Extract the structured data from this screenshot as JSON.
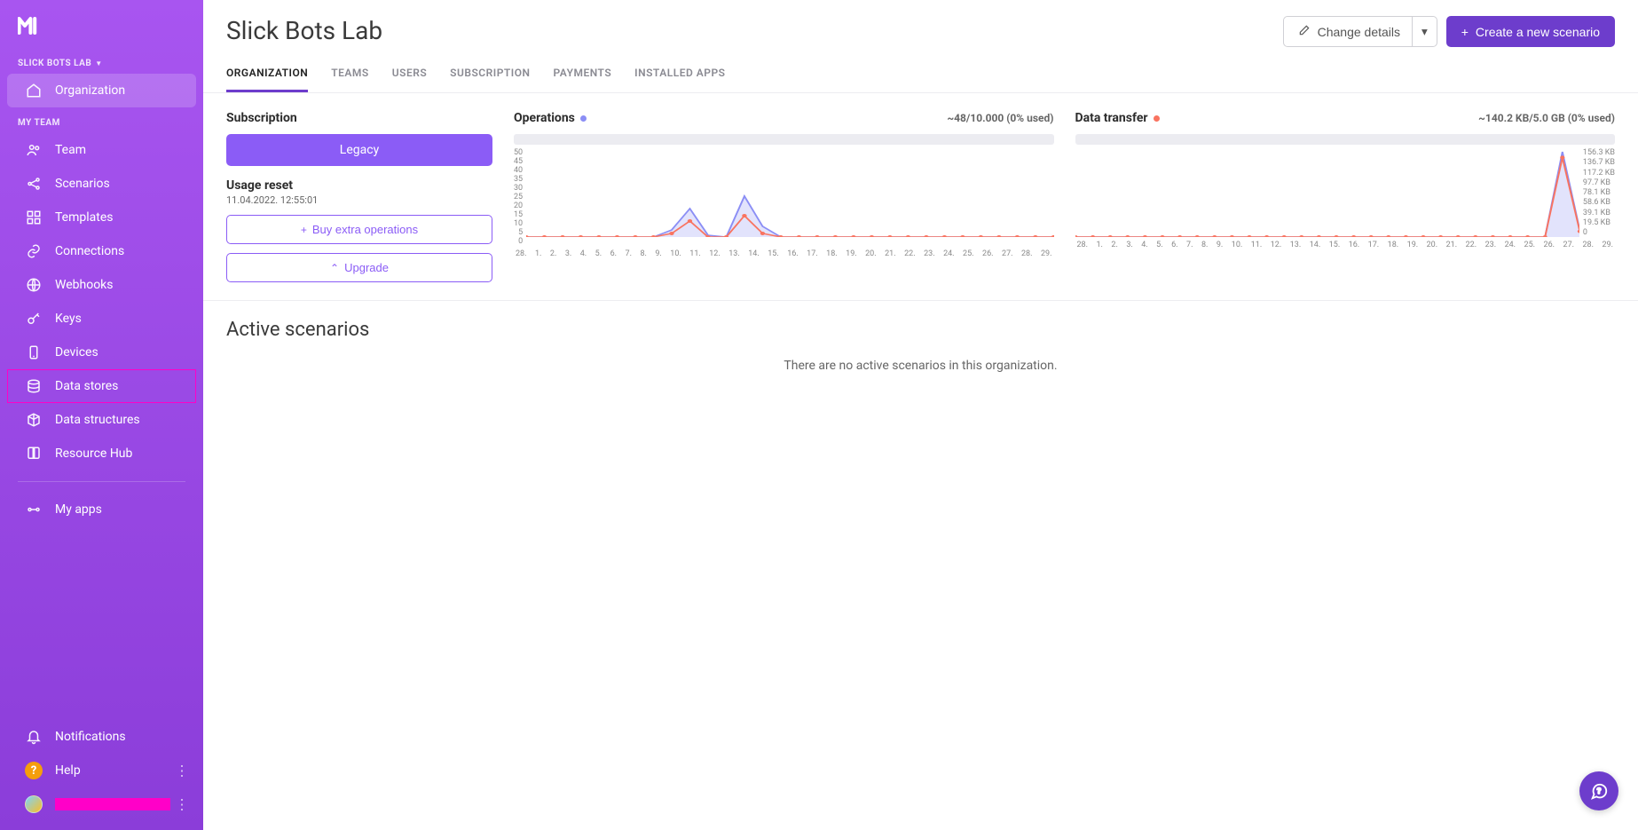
{
  "org": {
    "name": "Slick Bots Lab",
    "dropdown_label": "SLICK BOTS LAB"
  },
  "header": {
    "change_details": "Change details",
    "new_scenario": "Create a new scenario"
  },
  "tabs": [
    {
      "id": "organization",
      "label": "ORGANIZATION",
      "active": true
    },
    {
      "id": "teams",
      "label": "TEAMS"
    },
    {
      "id": "users",
      "label": "USERS"
    },
    {
      "id": "subscription",
      "label": "SUBSCRIPTION"
    },
    {
      "id": "payments",
      "label": "PAYMENTS"
    },
    {
      "id": "installed-apps",
      "label": "INSTALLED APPS"
    }
  ],
  "sidebar": {
    "team_label": "MY TEAM",
    "org_items": [
      {
        "id": "organization",
        "label": "Organization",
        "active": true
      }
    ],
    "team_items": [
      {
        "id": "team",
        "label": "Team"
      },
      {
        "id": "scenarios",
        "label": "Scenarios"
      },
      {
        "id": "templates",
        "label": "Templates"
      },
      {
        "id": "connections",
        "label": "Connections"
      },
      {
        "id": "webhooks",
        "label": "Webhooks"
      },
      {
        "id": "keys",
        "label": "Keys"
      },
      {
        "id": "devices",
        "label": "Devices"
      },
      {
        "id": "data-stores",
        "label": "Data stores",
        "highlighted": true
      },
      {
        "id": "data-structures",
        "label": "Data structures"
      },
      {
        "id": "resource-hub",
        "label": "Resource Hub"
      }
    ],
    "bottom_items": [
      {
        "id": "my-apps",
        "label": "My apps"
      }
    ],
    "footer": {
      "notifications": "Notifications",
      "help": "Help"
    }
  },
  "subscription": {
    "title": "Subscription",
    "plan": "Legacy",
    "usage_reset_label": "Usage reset",
    "usage_reset_ts": "11.04.2022. 12:55:01",
    "buy_ops": "Buy extra operations",
    "upgrade": "Upgrade"
  },
  "operations": {
    "title": "Operations",
    "meta": "~48/10.000 (0% used)"
  },
  "data_transfer": {
    "title": "Data transfer",
    "meta": "~140.2 KB/5.0 GB (0% used)"
  },
  "active_scenarios": {
    "title": "Active scenarios",
    "empty": "There are no active scenarios in this organization."
  },
  "chart_data": {
    "type": "line",
    "x": [
      "28.",
      "1.",
      "2.",
      "3.",
      "4.",
      "5.",
      "6.",
      "7.",
      "8.",
      "9.",
      "10.",
      "11.",
      "12.",
      "13.",
      "14.",
      "15.",
      "16.",
      "17.",
      "18.",
      "19.",
      "20.",
      "21.",
      "22.",
      "23.",
      "24.",
      "25.",
      "26.",
      "27.",
      "28.",
      "29."
    ],
    "series": {
      "operations_primary": [
        0,
        0,
        0,
        0,
        0,
        0,
        0,
        0,
        4,
        16,
        1,
        0,
        23,
        6,
        0,
        0,
        0,
        0,
        0,
        0,
        0,
        0,
        0,
        0,
        0,
        0,
        0,
        0,
        0,
        0
      ],
      "operations_secondary": [
        0,
        0,
        0,
        0,
        0,
        0,
        0,
        0,
        2,
        9,
        0,
        0,
        12,
        2,
        0,
        0,
        0,
        0,
        0,
        0,
        0,
        0,
        0,
        0,
        0,
        0,
        0,
        0,
        0,
        0
      ],
      "data_transfer_primary_kb": [
        0,
        0,
        0,
        0,
        0,
        0,
        0,
        0,
        0,
        0,
        0,
        0,
        0,
        0,
        0,
        0,
        0,
        0,
        0,
        0,
        0,
        0,
        0,
        0,
        0,
        0,
        0,
        0,
        150,
        12
      ],
      "data_transfer_secondary_kb": [
        0,
        0,
        0,
        0,
        0,
        0,
        0,
        0,
        0,
        0,
        0,
        0,
        0,
        0,
        0,
        0,
        0,
        0,
        0,
        0,
        0,
        0,
        0,
        0,
        0,
        0,
        0,
        0,
        140,
        10
      ]
    },
    "y_left": {
      "label": "",
      "ticks": [
        50,
        45,
        40,
        35,
        30,
        25,
        20,
        15,
        10,
        5,
        0
      ],
      "range": [
        0,
        50
      ]
    },
    "y_right": {
      "label": "",
      "ticks": [
        "156.3 KB",
        "136.7 KB",
        "117.2 KB",
        "97.7 KB",
        "78.1 KB",
        "58.6 KB",
        "39.1 KB",
        "19.5 KB",
        "0"
      ],
      "range_kb": [
        0,
        156.3
      ]
    },
    "colors": {
      "purple": "#8b8ef5",
      "orange": "#f97360"
    }
  }
}
